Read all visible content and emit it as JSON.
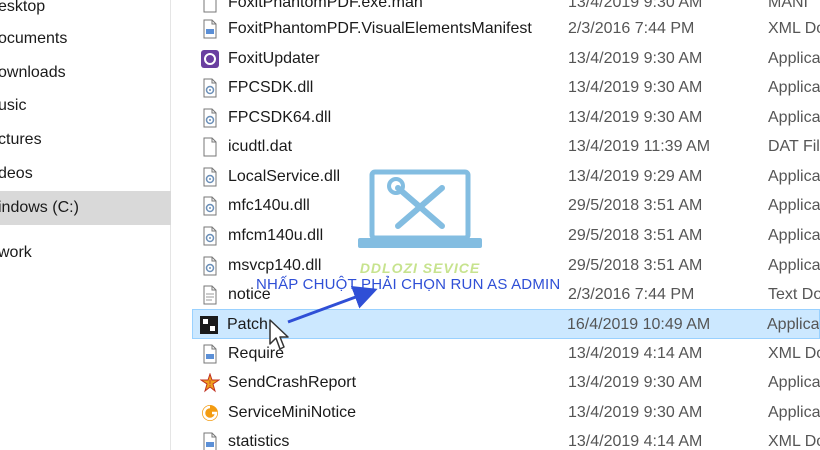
{
  "nav": {
    "items": [
      {
        "label": "esktop",
        "selected": false
      },
      {
        "label": "ocuments",
        "selected": false
      },
      {
        "label": "ownloads",
        "selected": false
      },
      {
        "label": "usic",
        "selected": false
      },
      {
        "label": "ctures",
        "selected": false
      },
      {
        "label": "deos",
        "selected": false
      },
      {
        "label": "indows (C:)",
        "selected": true
      },
      {
        "label": "",
        "selected": false
      },
      {
        "label": "work",
        "selected": false
      }
    ]
  },
  "files": [
    {
      "name": "FoxitPhantomPDF.exe.man",
      "date": "13/4/2019 9:30 AM",
      "type": "MANI",
      "icon": "manifest-file-icon"
    },
    {
      "name": "FoxitPhantomPDF.VisualElementsManifest",
      "date": "2/3/2016 7:44 PM",
      "type": "XML Do",
      "icon": "xml-file-icon"
    },
    {
      "name": "FoxitUpdater",
      "date": "13/4/2019 9:30 AM",
      "type": "Applica",
      "icon": "updater-app-icon"
    },
    {
      "name": "FPCSDK.dll",
      "date": "13/4/2019 9:30 AM",
      "type": "Applica",
      "icon": "dll-file-icon"
    },
    {
      "name": "FPCSDK64.dll",
      "date": "13/4/2019 9:30 AM",
      "type": "Applica",
      "icon": "dll-file-icon"
    },
    {
      "name": "icudtl.dat",
      "date": "13/4/2019 11:39 AM",
      "type": "DAT Fil",
      "icon": "blank-file-icon"
    },
    {
      "name": "LocalService.dll",
      "date": "13/4/2019 9:29 AM",
      "type": "Applica",
      "icon": "dll-file-icon"
    },
    {
      "name": "mfc140u.dll",
      "date": "29/5/2018 3:51 AM",
      "type": "Applica",
      "icon": "dll-file-icon"
    },
    {
      "name": "mfcm140u.dll",
      "date": "29/5/2018 3:51 AM",
      "type": "Applica",
      "icon": "dll-file-icon"
    },
    {
      "name": "msvcp140.dll",
      "date": "29/5/2018 3:51 AM",
      "type": "Applica",
      "icon": "dll-file-icon"
    },
    {
      "name": "notice",
      "date": "2/3/2016 7:44 PM",
      "type": "Text Do",
      "icon": "text-file-icon"
    },
    {
      "name": "Patch",
      "date": "16/4/2019 10:49 AM",
      "type": "Applica",
      "icon": "patch-app-icon",
      "selected": true
    },
    {
      "name": "Require",
      "date": "13/4/2019 4:14 AM",
      "type": "XML Do",
      "icon": "xml-file-icon"
    },
    {
      "name": "SendCrashReport",
      "date": "13/4/2019 9:30 AM",
      "type": "Applica",
      "icon": "crash-report-icon"
    },
    {
      "name": "ServiceMiniNotice",
      "date": "13/4/2019 9:30 AM",
      "type": "Applica",
      "icon": "foxit-service-icon"
    },
    {
      "name": "statistics",
      "date": "13/4/2019 4:14 AM",
      "type": "XML Do",
      "icon": "xml-file-icon"
    }
  ],
  "annotation": {
    "text": "NHẤP CHUỘT PHẢI CHỌN RUN AS ADMIN",
    "color": "#2f4fd6"
  },
  "watermark": {
    "text": "DDLOZI SEVICE",
    "icon": "tools-laptop-icon"
  },
  "colors": {
    "selection_bg": "#cce8ff",
    "selection_border": "#99d1ff",
    "nav_selected": "#d9d9d9"
  }
}
